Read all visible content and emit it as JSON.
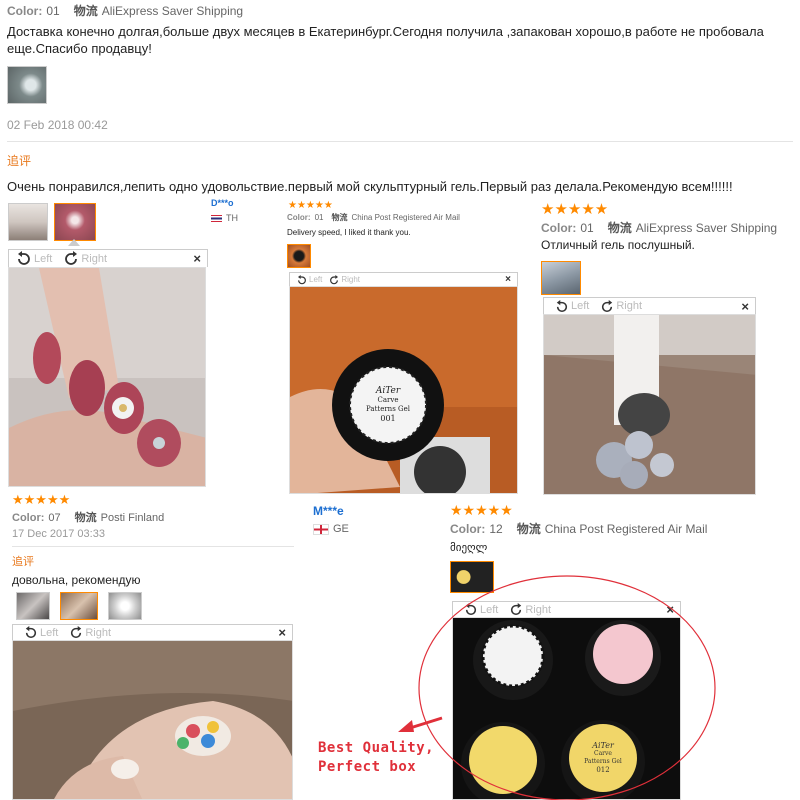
{
  "labels": {
    "color": "Color:",
    "logistics": "物流",
    "followup": "追评",
    "rotate_left": "Left",
    "rotate_right": "Right",
    "close": "×"
  },
  "review_top": {
    "color_value": "01",
    "shipping": "AliExpress Saver Shipping",
    "text": "Доставка конечно долгая,больше двух месяцев в Екатеринбург.Сегодня получила ,запакован хорошо,в работе не пробовала еще.Спасибо продавцу!",
    "date": "02 Feb 2018 00:42",
    "followup_text": "Очень понравился,лепить одно удовольствие.первый мой скульптурный гель.Первый раз делала.Рекомендую всем!!!!!!"
  },
  "review_finland": {
    "stars": "★★★★★",
    "color_value": "07",
    "shipping": "Posti Finland",
    "date": "17 Dec 2017 03:33",
    "followup_text": "довольна, рекомендую"
  },
  "review_th": {
    "user": "D***o",
    "country": "TH",
    "stars": "★★★★★",
    "color_value": "01",
    "shipping": "China Post Registered Air Mail",
    "text": "Delivery speed, I liked it thank you.",
    "product_label_1": "AiTer",
    "product_label_2": "Carve",
    "product_label_3": "Patterns Gel",
    "product_label_4": "001"
  },
  "review_right": {
    "stars": "★★★★★",
    "color_value": "01",
    "shipping": "AliExpress Saver Shipping",
    "text": "Отличный гель послушный."
  },
  "review_ge": {
    "user": "M***e",
    "country": "GE",
    "stars": "★★★★★",
    "color_value": "12",
    "shipping": "China Post Registered Air Mail",
    "text": "მიეღლ"
  },
  "promo": {
    "line1": "Best Quality,",
    "line2": "Perfect box",
    "jar_label_top_left": "",
    "jar_label_bottom_1": "AiTer",
    "jar_label_bottom_2": "Carve",
    "jar_label_bottom_3": "Patterns Gel",
    "jar_label_bottom_4": "012"
  },
  "colors": {
    "accent_orange": "#ff8a00",
    "followup_orange": "#e8781c",
    "user_blue": "#1d6fd1",
    "promo_red": "#e0303a"
  }
}
